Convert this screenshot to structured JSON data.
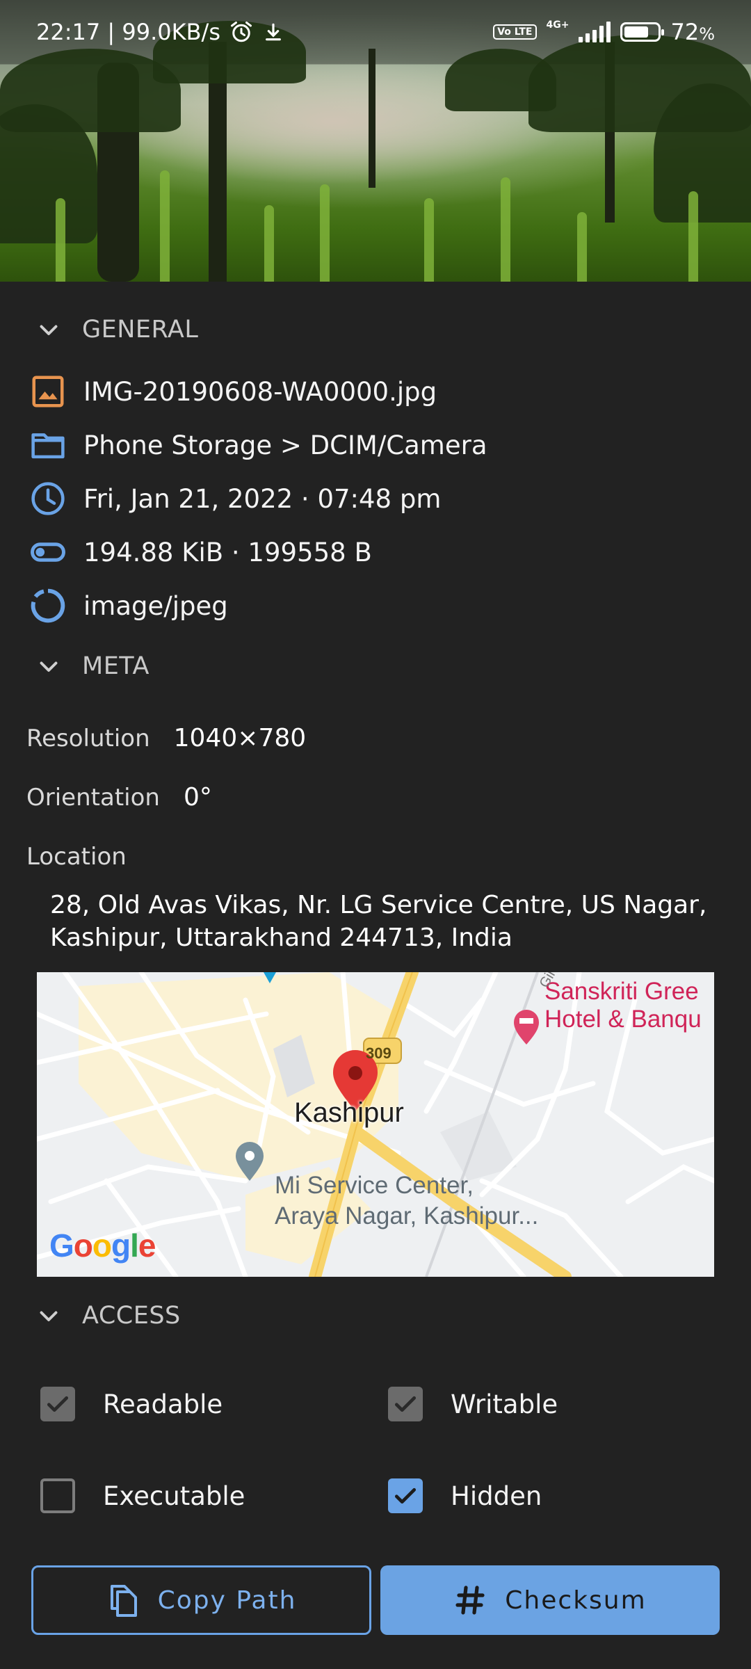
{
  "status_bar": {
    "time_speed": "22:17 | 99.0KB/s",
    "alarm_icon": "alarm-clock-icon",
    "download_icon": "download-icon",
    "volte": "Vo LTE",
    "network": "4G+",
    "battery_percent": "72",
    "battery_unit": "%",
    "battery_level": 0.72
  },
  "general": {
    "header": "GENERAL",
    "filename": "IMG-20190608-WA0000.jpg",
    "path": "Phone Storage > DCIM/Camera",
    "date": "Fri, Jan 21, 2022 · 07:48 pm",
    "size": "194.88 KiB · 199558 B",
    "mime": "image/jpeg"
  },
  "meta": {
    "header": "META",
    "resolution_label": "Resolution",
    "resolution_value": "1040×780",
    "orientation_label": "Orientation",
    "orientation_value": "0°",
    "location_label": "Location",
    "address": "28, Old Avas Vikas, Nr. LG Service Centre, US Nagar, Kashipur, Uttarakhand 244713, India"
  },
  "map": {
    "city": "Kashipur",
    "road_shield": "309",
    "poi_hotel": "Sanskriti Gree\nHotel & Banqu",
    "poi_service": "Mi Service Center,\nAraya Nagar, Kashipur...",
    "road_label": "Gir",
    "logo": "Google",
    "colors": {
      "background": "#eef0f2",
      "urban": "#fbf2d4",
      "highway": "#f7d36a",
      "pin": "#e53935",
      "hotel_pin": "#e0446c",
      "service_pin": "#78909c"
    }
  },
  "access": {
    "header": "ACCESS",
    "readable": "Readable",
    "writable": "Writable",
    "executable": "Executable",
    "hidden": "Hidden",
    "readable_checked": true,
    "writable_checked": true,
    "executable_checked": false,
    "hidden_checked": true
  },
  "buttons": {
    "copy_path": "Copy Path",
    "checksum": "Checksum"
  },
  "colors": {
    "accent": "#6aa3e6",
    "background": "#222222",
    "file_icon": "#e8944f"
  }
}
